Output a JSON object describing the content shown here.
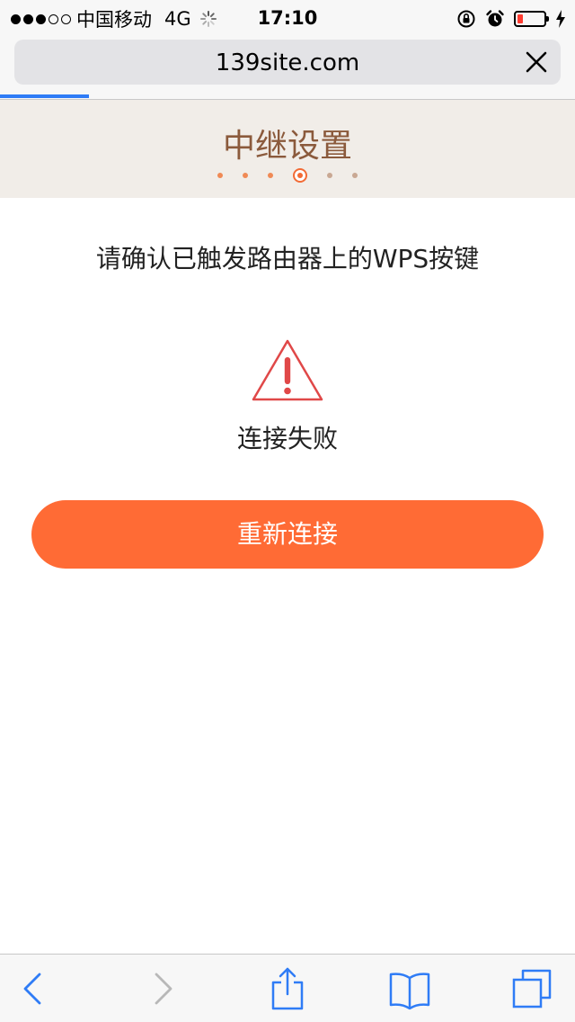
{
  "status_bar": {
    "carrier": "中国移动",
    "network": "4G",
    "time": "17:10",
    "battery_level": 0.2,
    "battery_color": "#ff3b30"
  },
  "browser": {
    "url": "139site.com",
    "close_icon": "close-icon",
    "load_progress": 0.155,
    "progress_color": "#2f7cf6"
  },
  "page": {
    "title": "中继设置",
    "steps": {
      "total": 6,
      "current": 4
    },
    "instruction": "请确认已触发路由器上的WPS按键",
    "status_icon": "warning-triangle-icon",
    "status": "连接失败",
    "action_label": "重新连接",
    "accent_color": "#ff6b35",
    "header_bg": "#f1ede8",
    "title_color": "#8b5a3c"
  },
  "toolbar": {
    "items": [
      "back-icon",
      "forward-icon",
      "share-icon",
      "bookmarks-icon",
      "tabs-icon"
    ]
  }
}
